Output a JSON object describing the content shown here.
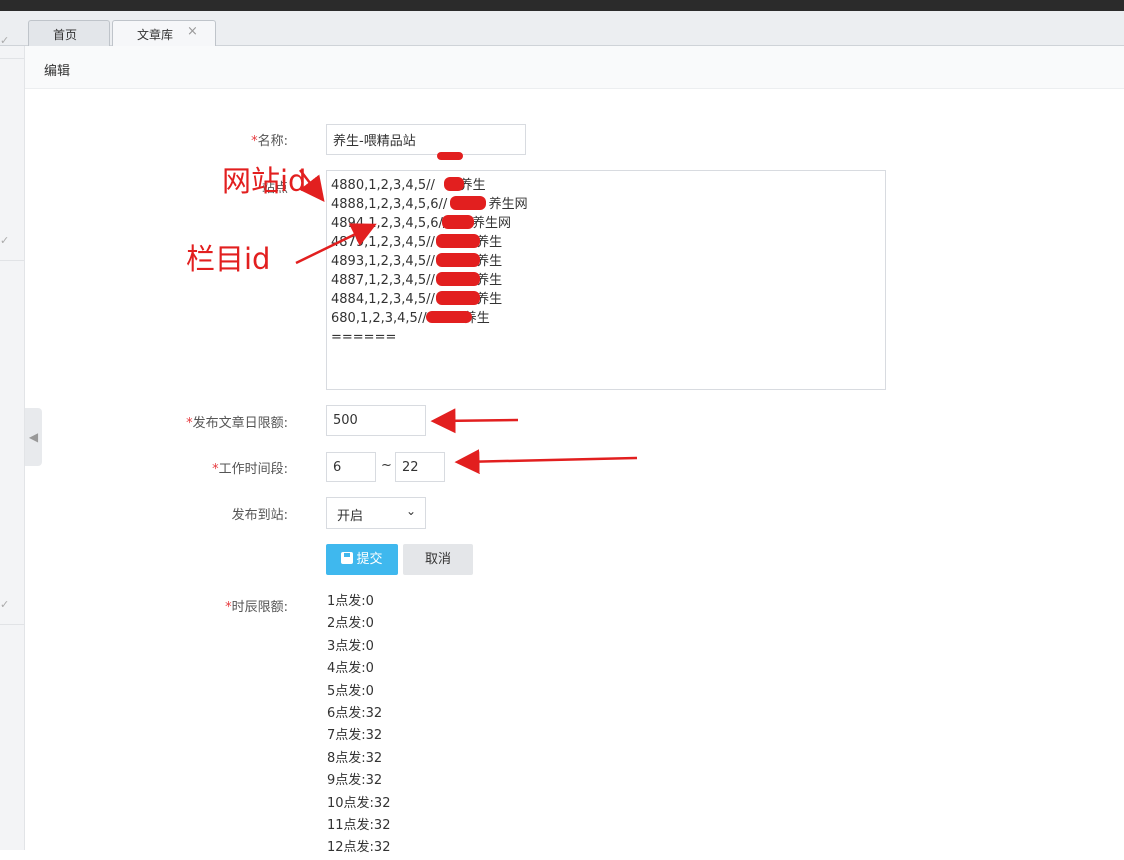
{
  "tabs": [
    {
      "label": "首页",
      "active": false
    },
    {
      "label": "文章库",
      "active": true
    }
  ],
  "tab_close": "×",
  "subheader": {
    "title": "编辑"
  },
  "form": {
    "required_mark": "*",
    "name": {
      "label": "名称:",
      "value": "养生-喂精品站"
    },
    "sites": {
      "label": "站点",
      "lines": [
        "4880,1,2,3,4,5//      养生",
        "4888,1,2,3,4,5,6//          养生网",
        "4894,1,2,3,4,5,6//      养生网",
        "4879,1,2,3,4,5//          养生",
        "4893,1,2,3,4,5//          养生",
        "4887,1,2,3,4,5//          养生",
        "4884,1,2,3,4,5//          养生",
        "680,1,2,3,4,5//         养生",
        "======"
      ]
    },
    "daily_limit": {
      "label": "发布文章日限额:",
      "value": "500"
    },
    "work_hours": {
      "label": "工作时间段:",
      "from": "6",
      "separator": "~",
      "to": "22"
    },
    "publish": {
      "label": "发布到站:",
      "selected": "开启"
    },
    "buttons": {
      "submit": "提交",
      "cancel": "取消"
    },
    "hourly": {
      "label": "时辰限额:",
      "items": [
        "1点发:0",
        "2点发:0",
        "3点发:0",
        "4点发:0",
        "5点发:0",
        "6点发:32",
        "7点发:32",
        "8点发:32",
        "9点发:32",
        "10点发:32",
        "11点发:32",
        "12点发:32"
      ]
    }
  },
  "annotations": {
    "site_id": "网站id",
    "column_id": "栏目id"
  },
  "colors": {
    "accent": "#3fb8ee",
    "annotation": "#e21f1f",
    "required": "#e6393d"
  }
}
